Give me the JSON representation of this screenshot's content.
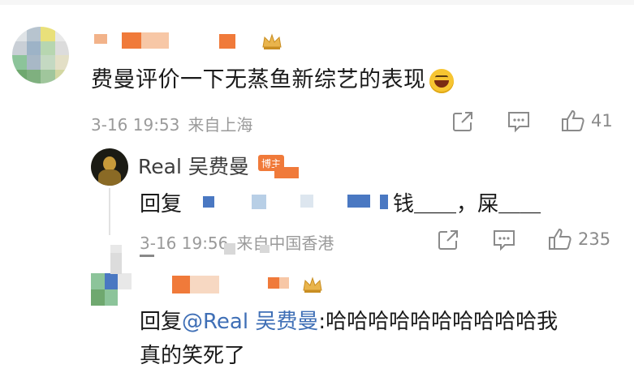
{
  "comment": {
    "text": "费曼评价一下无蒸鱼新综艺的表现",
    "emoji": "laughing-face",
    "time": "3-16 19:53",
    "source": "来自上海",
    "like_count": "41"
  },
  "reply": {
    "author": "Real 吴费曼",
    "badge": "博主",
    "prefix": "回复",
    "text_part1": "钱",
    "blank1": "＿＿",
    "separator": "，",
    "text_part2": "屎",
    "blank2": "＿＿",
    "time": "3-16 19:56",
    "source": "来自中国香港",
    "like_count": "235"
  },
  "reply2": {
    "prefix": "回复",
    "mention": "@Real 吴费曼",
    "text_line1": ":哈哈哈哈哈哈哈哈哈哈我",
    "text_line2": "真的笑死了"
  },
  "colors": {
    "orange": "#f07a3a",
    "link_blue": "#3f6fb6",
    "meta_gray": "#9a9a9a",
    "mosaic_blue": "#4a78c2",
    "mosaic_yellow": "#e9e07a",
    "mosaic_green": "#8cc49a"
  }
}
